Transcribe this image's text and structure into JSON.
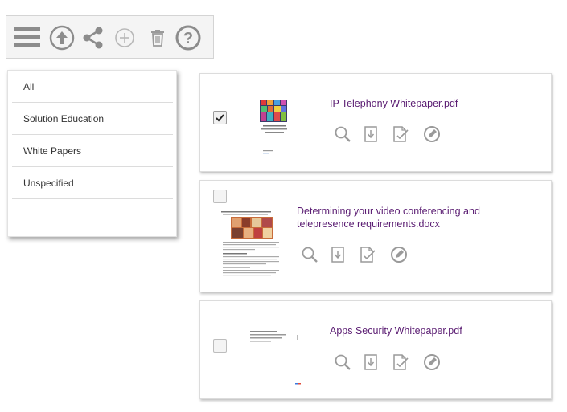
{
  "toolbar": {
    "icons": [
      "menu-icon",
      "upload-icon",
      "share-icon",
      "add-icon",
      "trash-icon",
      "help-icon"
    ]
  },
  "filters": {
    "items": [
      {
        "label": "All"
      },
      {
        "label": "Solution Education"
      },
      {
        "label": "White Papers"
      },
      {
        "label": "Unspecified"
      }
    ]
  },
  "documents": [
    {
      "title": "IP Telephony Whitepaper.pdf",
      "checked": true,
      "actions": [
        "preview-icon",
        "download-icon",
        "edit-doc-icon",
        "approve-icon"
      ]
    },
    {
      "title_line1": "Determining your video conferencing and",
      "title_line2": "telepresence requirements.docx",
      "checked": false,
      "actions": [
        "preview-icon",
        "download-icon",
        "edit-doc-icon",
        "approve-icon"
      ]
    },
    {
      "title": "Apps Security Whitepaper.pdf",
      "checked": false,
      "actions": [
        "preview-icon",
        "download-icon",
        "edit-doc-icon",
        "approve-icon"
      ]
    }
  ],
  "colors": {
    "title": "#5a1c72",
    "icon": "#9a9a9a",
    "toolbar_icon": "#8c8c8c"
  }
}
